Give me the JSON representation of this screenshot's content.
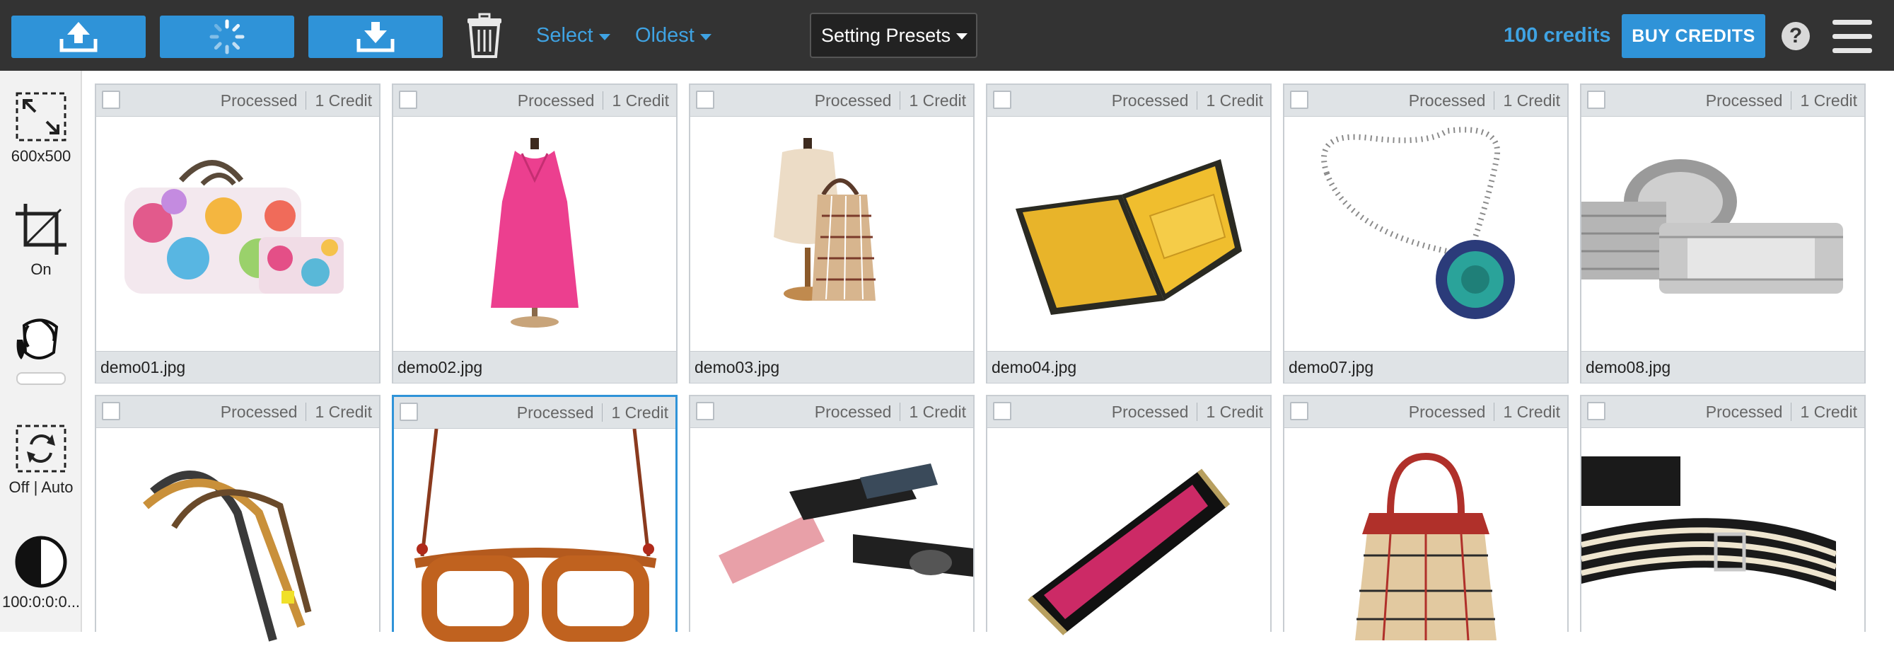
{
  "toolbar": {
    "upload_icon": "upload-icon",
    "processing_icon": "spinner-icon",
    "download_icon": "download-icon",
    "trash_icon": "trash-icon",
    "select_label": "Select",
    "sort_label": "Oldest",
    "presets_label": "Setting Presets",
    "credits_text": "100 credits",
    "buy_label": "BUY CREDITS",
    "help_label": "?",
    "accent_color": "#2f93d8",
    "bar_color": "#333333"
  },
  "sidebar": {
    "size_label": "600x500",
    "crop_label": "On",
    "rotate_label": "Off | Auto",
    "contrast_label": "100:0:0:0..."
  },
  "grid": {
    "row1": [
      {
        "status": "Processed",
        "credit": "1 Credit",
        "filename": "demo01.jpg"
      },
      {
        "status": "Processed",
        "credit": "1 Credit",
        "filename": "demo02.jpg"
      },
      {
        "status": "Processed",
        "credit": "1 Credit",
        "filename": "demo03.jpg"
      },
      {
        "status": "Processed",
        "credit": "1 Credit",
        "filename": "demo04.jpg"
      },
      {
        "status": "Processed",
        "credit": "1 Credit",
        "filename": "demo07.jpg"
      },
      {
        "status": "Processed",
        "credit": "1 Credit",
        "filename": "demo08.jpg"
      }
    ],
    "row2": [
      {
        "status": "Processed",
        "credit": "1 Credit"
      },
      {
        "status": "Processed",
        "credit": "1 Credit",
        "selected": true
      },
      {
        "status": "Processed",
        "credit": "1 Credit"
      },
      {
        "status": "Processed",
        "credit": "1 Credit"
      },
      {
        "status": "Processed",
        "credit": "1 Credit"
      },
      {
        "status": "Processed",
        "credit": "1 Credit"
      }
    ]
  }
}
